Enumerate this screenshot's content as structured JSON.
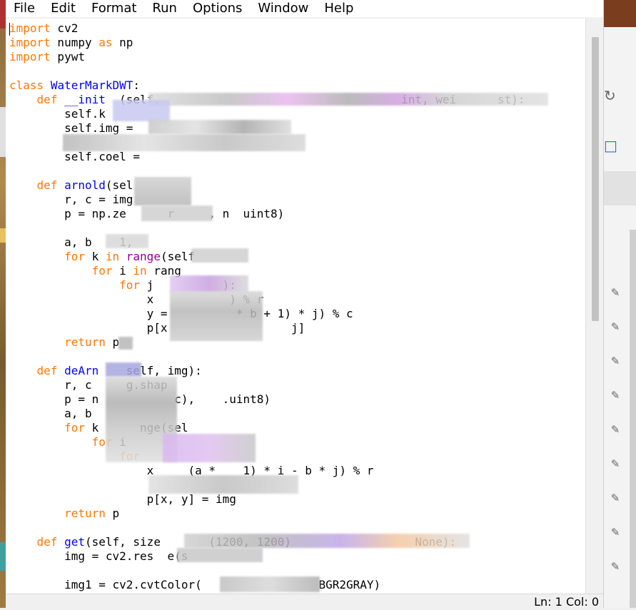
{
  "menu": [
    "File",
    "Edit",
    "Format",
    "Run",
    "Options",
    "Window",
    "Help"
  ],
  "code_lines": [
    "import cv2",
    "import numpy as np",
    "import pywt",
    "",
    "class WaterMarkDWT:",
    "    def __init  (self,                                   int, wei      st):",
    "        self.k",
    "        self.img =",
    "",
    "        self.coel = ",
    "",
    "    def arnold(sel",
    "        r, c = img",
    "        p = np.ze      r     , n  uint8)",
    "",
    "        a, b    1,",
    "        for k in range(self",
    "            for i in rang",
    "                for j          ):",
    "                    x           ) % r",
    "                    y =          * b + 1) * j) % c",
    "                    p[x                  j]",
    "        return p",
    "",
    "    def deArn    self, img):",
    "        r, c     g.shap",
    "        p = n           c),    .uint8)",
    "        a, b",
    "        for k      nge(sel",
    "            for i",
    "                for",
    "                    x     (a *    1) * i - b * j) % r",
    "",
    "                    p[x, y] = img",
    "        return p",
    "",
    "    def get(self, size       (1200, 1200)                  None):",
    "        img = cv2.res  e(s",
    "",
    "        img1 = cv2.cvtColor(                 BGR2GRAY)"
  ],
  "status": {
    "position": "Ln: 1  Col: 0"
  },
  "colors": {
    "keyword": "#ff7700",
    "builtin": "#900090",
    "definition": "#0000ff",
    "text": "#000000"
  },
  "icons": [
    "pin-icon",
    "refresh-icon",
    "square-icon"
  ]
}
